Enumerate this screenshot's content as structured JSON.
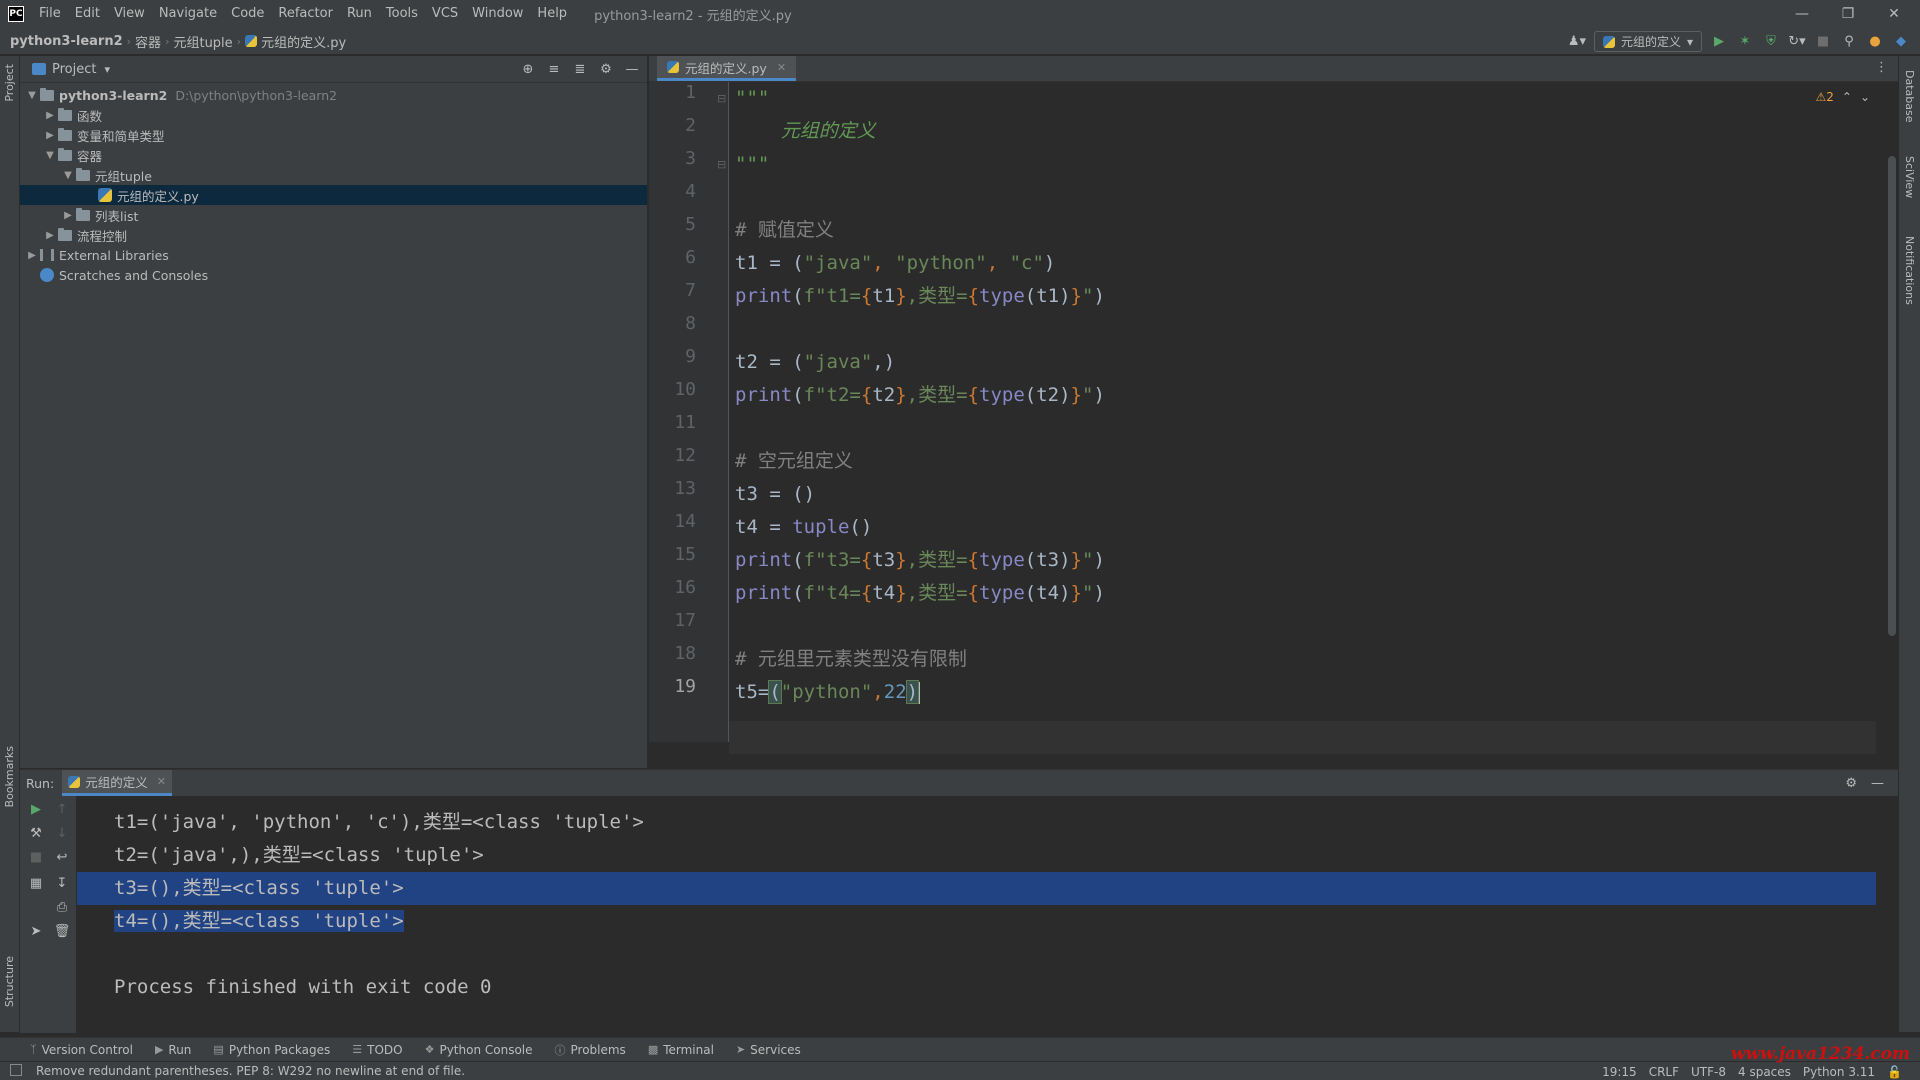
{
  "app": {
    "logo": "PC",
    "window_title": "python3-learn2 - 元组的定义.py"
  },
  "menu": [
    "File",
    "Edit",
    "View",
    "Navigate",
    "Code",
    "Refactor",
    "Run",
    "Tools",
    "VCS",
    "Window",
    "Help"
  ],
  "breadcrumb": [
    "python3-learn2",
    "容器",
    "元组tuple",
    "元组的定义.py"
  ],
  "run_config": {
    "label": "元组的定义"
  },
  "left_stripe": {
    "project": "Project",
    "bookmarks": "Bookmarks",
    "structure": "Structure"
  },
  "right_stripe": {
    "database": "Database",
    "sciview": "SciView",
    "notifications": "Notifications"
  },
  "project_panel": {
    "title": "Project",
    "root": {
      "label": "python3-learn2",
      "path": "D:\\python\\python3-learn2"
    },
    "items": [
      {
        "label": "函数"
      },
      {
        "label": "变量和简单类型"
      },
      {
        "label": "容器"
      },
      {
        "label": "元组tuple"
      },
      {
        "label": "元组的定义.py"
      },
      {
        "label": "列表list"
      },
      {
        "label": "流程控制"
      },
      {
        "label": "External Libraries"
      },
      {
        "label": "Scratches and Consoles"
      }
    ]
  },
  "editor": {
    "tab": "元组的定义.py",
    "inspection": "⚠2",
    "line_numbers": [
      "1",
      "2",
      "3",
      "4",
      "5",
      "6",
      "7",
      "8",
      "9",
      "10",
      "11",
      "12",
      "13",
      "14",
      "15",
      "16",
      "17",
      "18",
      "19"
    ],
    "code": {
      "l1": "\"\"\"",
      "l2": "    元组的定义",
      "l3": "\"\"\"",
      "l5": "# 赋值定义",
      "l6_a": "t1 = (",
      "l6_s1": "\"java\"",
      "l6_c1": ", ",
      "l6_s2": "\"python\"",
      "l6_c2": ", ",
      "l6_s3": "\"c\"",
      "l6_e": ")",
      "l7_fn": "print",
      "l7_a": "(",
      "l7_s1": "f\"t1=",
      "l7_b1": "{",
      "l7_v1": "t1",
      "l7_b2": "}",
      "l7_s2": ",类型=",
      "l7_b3": "{",
      "l7_fn2": "type",
      "l7_v2": "(t1)",
      "l7_b4": "}",
      "l7_s3": "\"",
      "l7_e": ")",
      "l9_a": "t2 = (",
      "l9_s1": "\"java\"",
      "l9_e": ",)",
      "l10_fn": "print",
      "l10_a": "(",
      "l10_s1": "f\"t2=",
      "l10_b1": "{",
      "l10_v1": "t2",
      "l10_b2": "}",
      "l10_s2": ",类型=",
      "l10_b3": "{",
      "l10_fn2": "type",
      "l10_v2": "(t2)",
      "l10_b4": "}",
      "l10_s3": "\"",
      "l10_e": ")",
      "l12": "# 空元组定义",
      "l13": "t3 = ()",
      "l14_a": "t4 = ",
      "l14_fn": "tuple",
      "l14_e": "()",
      "l15_fn": "print",
      "l15_a": "(",
      "l15_s1": "f\"t3=",
      "l15_b1": "{",
      "l15_v1": "t3",
      "l15_b2": "}",
      "l15_s2": ",类型=",
      "l15_b3": "{",
      "l15_fn2": "type",
      "l15_v2": "(t3)",
      "l15_b4": "}",
      "l15_s3": "\"",
      "l15_e": ")",
      "l16_fn": "print",
      "l16_a": "(",
      "l16_s1": "f\"t4=",
      "l16_b1": "{",
      "l16_v1": "t4",
      "l16_b2": "}",
      "l16_s2": ",类型=",
      "l16_b3": "{",
      "l16_fn2": "type",
      "l16_v2": "(t4)",
      "l16_b4": "}",
      "l16_s3": "\"",
      "l16_e": ")",
      "l18": "# 元组里元素类型没有限制",
      "l19_a": "t5=",
      "l19_p1": "(",
      "l19_s1": "\"python\"",
      "l19_c": ",",
      "l19_n": "22",
      "l19_p2": ")"
    }
  },
  "run_panel": {
    "label": "Run:",
    "tab": "元组的定义",
    "output": [
      {
        "pre": "",
        "sel": "",
        "text": "t1=('java', 'python', 'c'),类型=<class 'tuple'>"
      },
      {
        "pre": "",
        "sel": "",
        "text": "t2=('java',),类型=<class 'tuple'>"
      },
      {
        "pre": "t3=",
        "sel": "(),类型=<class 'tuple'>",
        "text": ""
      },
      {
        "pre": "",
        "sel": "t4=(),类型=<class 'tuple'>",
        "text": ""
      },
      {
        "pre": "",
        "sel": "",
        "text": ""
      },
      {
        "pre": "",
        "sel": "",
        "text": "Process finished with exit code 0"
      }
    ]
  },
  "bottom_tabs": [
    "Version Control",
    "Run",
    "Python Packages",
    "TODO",
    "Python Console",
    "Problems",
    "Terminal",
    "Services"
  ],
  "status": {
    "message": "Remove redundant parentheses. PEP 8: W292 no newline at end of file.",
    "position": "19:15",
    "line_sep": "CRLF",
    "encoding": "UTF-8",
    "indent": "4 spaces",
    "interpreter": "Python 3.11"
  },
  "watermark": "www.java1234.com",
  "colors": {
    "accent": "#4a88c7",
    "selection": "#214283",
    "string": "#6a8759",
    "comment": "#808080",
    "builtin": "#8888c6",
    "brace": "#cc7832"
  }
}
